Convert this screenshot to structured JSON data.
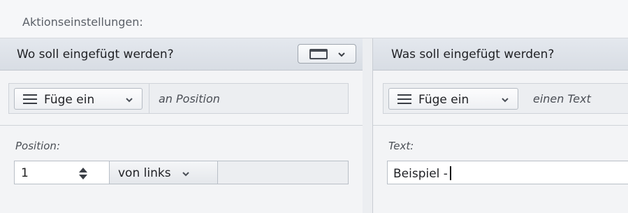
{
  "title": "Aktionseinstellungen:",
  "left_panel": {
    "header": "Wo soll eingefügt werden?",
    "window_icon": "window-icon",
    "operation_button": "Füge ein",
    "operation_hint": "an Position",
    "field_label": "Position:",
    "position_value": "1",
    "direction_dropdown": "von links"
  },
  "right_panel": {
    "header": "Was soll eingefügt werden?",
    "operation_button": "Füge ein",
    "operation_hint": "einen Text",
    "field_label": "Text:",
    "text_value": "Beispiel -"
  }
}
